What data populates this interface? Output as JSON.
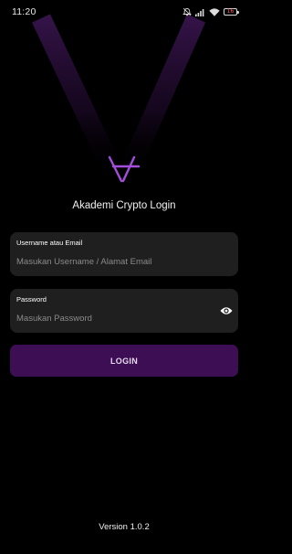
{
  "status_bar": {
    "time": "11:20",
    "icons": [
      "alarm-off-icon",
      "signal-icon",
      "wifi-icon",
      "battery-icon"
    ],
    "battery_level": "16"
  },
  "app": {
    "logo": "akademi-crypto-logo-icon",
    "title": "Akademi Crypto Login",
    "accent_color": "#a24ddb",
    "button_color": "#3d0e53"
  },
  "form": {
    "username": {
      "label": "Username atau Email",
      "placeholder": "Masukan Username / Alamat Email",
      "value": ""
    },
    "password": {
      "label": "Password",
      "placeholder": "Masukan Password",
      "value": "",
      "toggle_icon": "eye-icon"
    },
    "login_label": "LOGIN"
  },
  "footer": {
    "version": "Version 1.0.2"
  }
}
